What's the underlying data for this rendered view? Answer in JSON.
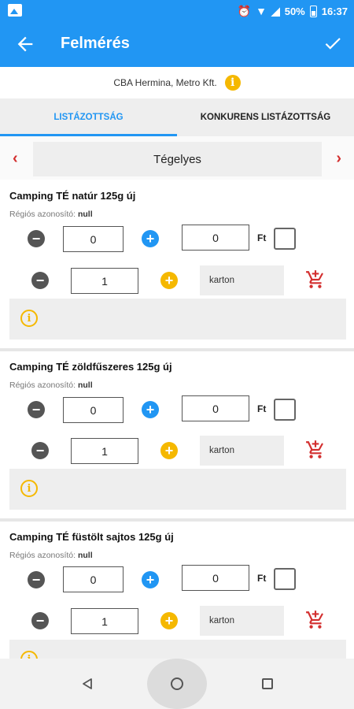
{
  "status_bar": {
    "battery": "50%",
    "time": "16:37"
  },
  "app_bar": {
    "title": "Felmérés"
  },
  "store": {
    "label": "CBA Hermina, Metro Kft."
  },
  "tabs": [
    {
      "label": "LISTÁZOTTSÁG",
      "active": true
    },
    {
      "label": "KONKURENS LISTÁZOTTSÁG",
      "active": false
    }
  ],
  "category": {
    "label": "Tégelyes"
  },
  "products": [
    {
      "name": "Camping TÉ natúr 125g új",
      "region_label": "Régiós azonosító:",
      "region_value": "null",
      "qty": "0",
      "price": "0",
      "currency": "Ft",
      "order_qty": "1",
      "unit": "karton"
    },
    {
      "name": "Camping TÉ zöldfűszeres 125g új",
      "region_label": "Régiós azonosító:",
      "region_value": "null",
      "qty": "0",
      "price": "0",
      "currency": "Ft",
      "order_qty": "1",
      "unit": "karton"
    },
    {
      "name": "Camping TÉ füstölt sajtos 125g új",
      "region_label": "Régiós azonosító:",
      "region_value": "null",
      "qty": "0",
      "price": "0",
      "currency": "Ft",
      "order_qty": "1",
      "unit": "karton"
    }
  ],
  "colors": {
    "primary": "#2196f3",
    "accent": "#f5b800",
    "danger": "#d32f2f"
  }
}
